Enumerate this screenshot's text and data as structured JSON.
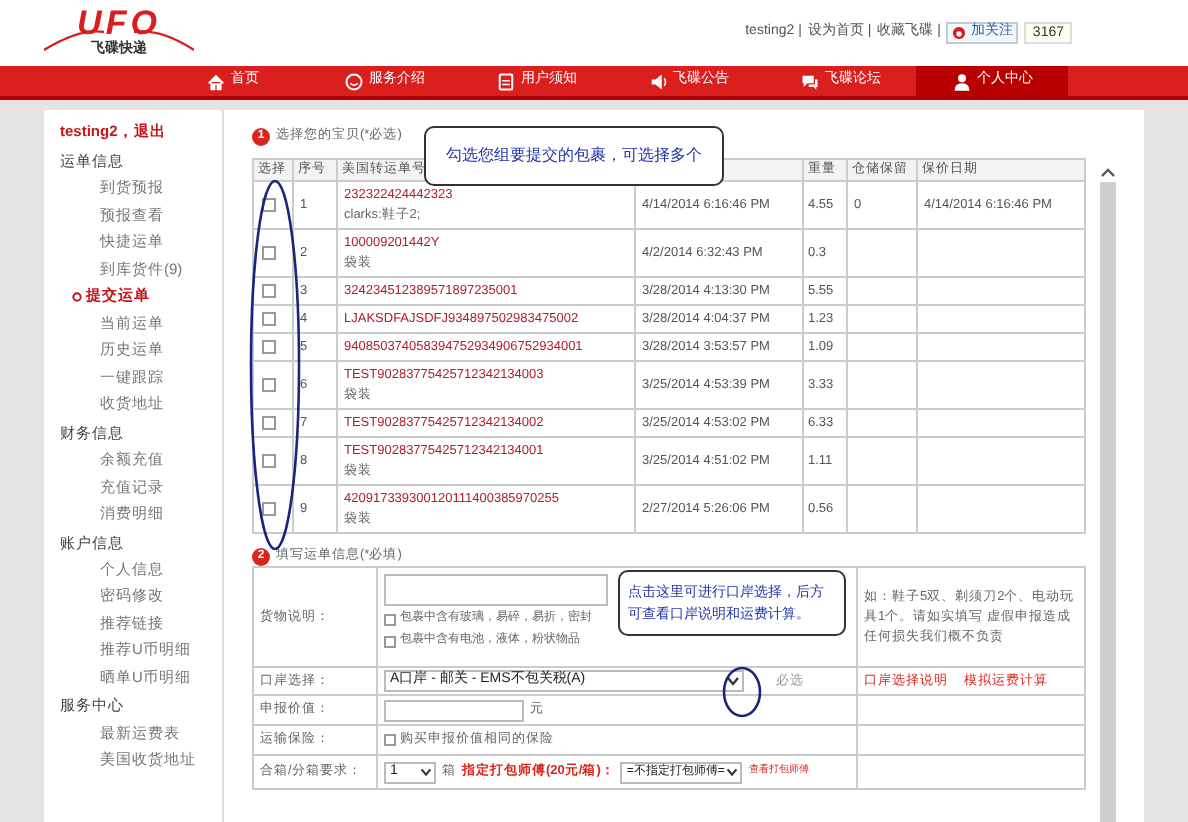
{
  "header": {
    "logo": "UFO",
    "tagline": "飞碟快递",
    "links": [
      "testing2 |",
      "设为首页 |",
      "收藏飞碟 |"
    ],
    "follow": "加关注",
    "count": "3167"
  },
  "nav": [
    {
      "label": "首页",
      "selected": false
    },
    {
      "label": "服务介绍",
      "selected": false
    },
    {
      "label": "用户须知",
      "selected": false
    },
    {
      "label": "飞碟公告",
      "selected": false
    },
    {
      "label": "飞碟论坛",
      "selected": false
    },
    {
      "label": "个人中心",
      "selected": true
    }
  ],
  "sidebar": {
    "user": "testing2，退出",
    "groups": [
      {
        "title": "运单信息",
        "items": [
          {
            "label": "到货预报",
            "selected": false
          },
          {
            "label": "预报查看",
            "selected": false
          },
          {
            "label": "快捷运单",
            "selected": false
          },
          {
            "label": "到库货件(9)",
            "selected": false
          },
          {
            "label": "提交运单",
            "selected": true
          },
          {
            "label": "当前运单",
            "selected": false
          },
          {
            "label": "历史运单",
            "selected": false
          },
          {
            "label": "一键跟踪",
            "selected": false
          },
          {
            "label": "收货地址",
            "selected": false
          }
        ]
      },
      {
        "title": "财务信息",
        "items": [
          {
            "label": "余额充值",
            "selected": false
          },
          {
            "label": "充值记录",
            "selected": false
          },
          {
            "label": "消费明细",
            "selected": false
          }
        ]
      },
      {
        "title": "账户信息",
        "items": [
          {
            "label": "个人信息",
            "selected": false
          },
          {
            "label": "密码修改",
            "selected": false
          },
          {
            "label": "推荐链接",
            "selected": false
          },
          {
            "label": "推荐U币明细",
            "selected": false
          },
          {
            "label": "晒单U币明细",
            "selected": false
          }
        ]
      },
      {
        "title": "服务中心",
        "items": [
          {
            "label": "最新运费表",
            "selected": false
          },
          {
            "label": "美国收货地址",
            "selected": false
          }
        ]
      }
    ]
  },
  "section1": {
    "number": "1",
    "title": "选择您的宝贝(*必选)",
    "columns": [
      "选择",
      "序号",
      "美国转运单号",
      "",
      "重量",
      "仓储保留",
      "保价日期"
    ],
    "rows": [
      {
        "checked": false,
        "seq": "1",
        "tracking": "232322424442323",
        "note": "clarks:鞋子2;",
        "date": "4/14/2014 6:16:46 PM",
        "weight": "4.55",
        "storage": "0",
        "insured": "4/14/2014 6:16:46 PM"
      },
      {
        "checked": false,
        "seq": "2",
        "tracking": "100009201442Y",
        "note": "袋装",
        "date": "4/2/2014 6:32:43 PM",
        "weight": "0.3"
      },
      {
        "checked": false,
        "seq": "3",
        "tracking": "3242345123895718972350​01",
        "date": "3/28/2014 4:13:30 PM",
        "weight": "5.55"
      },
      {
        "checked": false,
        "seq": "4",
        "tracking": "LJAKSDFAJSDFJ934897502983475002",
        "date": "3/28/2014 4:04:37 PM",
        "weight": "1.23"
      },
      {
        "checked": false,
        "seq": "5",
        "tracking": "940850374058394752934906752934001",
        "date": "3/28/2014 3:53:57 PM",
        "weight": "1.09"
      },
      {
        "checked": false,
        "seq": "6",
        "tracking": "TEST902837754257123421340​03",
        "note": "袋装",
        "date": "3/25/2014 4:53:39 PM",
        "weight": "3.33"
      },
      {
        "checked": false,
        "seq": "7",
        "tracking": "TEST90283775425712342134002",
        "date": "3/25/2014 4:53:02 PM",
        "weight": "6.33"
      },
      {
        "checked": false,
        "seq": "8",
        "tracking": "TEST90283775425712342134001",
        "note": "袋装",
        "date": "3/25/2014 4:51:02 PM",
        "weight": "1.11"
      },
      {
        "checked": false,
        "seq": "9",
        "tracking": "420917339300120111400385970255",
        "note": "袋装",
        "date": "2/27/2014 5:26:06 PM",
        "weight": "0.56"
      }
    ]
  },
  "section2": {
    "number": "2",
    "title": "填写运单信息(*必填)",
    "goods": {
      "label": "货物说明：",
      "options": [
        {
          "label": "包裹中含有玻璃，易碎，易折，密封",
          "checked": false
        },
        {
          "label": "包裹中含有电池，液体，粉状物品",
          "checked": false
        }
      ],
      "hint": "如：鞋子5双、剃须刀2个、电动玩具1个。请如实填写 虚假申报造成任何损失我们概不负责"
    },
    "port": {
      "label": "口岸选择：",
      "value": "A口岸 - 邮关 - EMS不包关税(A)",
      "required": "必选",
      "links": [
        "口岸选择说明",
        "模拟运费计算"
      ]
    },
    "declared": {
      "label": "申报价值：",
      "unit": "元"
    },
    "insurance": {
      "label": "运输保险：",
      "option": "购买申报价值相同的保险",
      "checked": false
    },
    "boxes": {
      "label": "合箱/分箱要求：",
      "count": "1",
      "unit": "箱",
      "packer_label": "指定打包师傅(20元/箱)：",
      "packer": "=不指定打包师傅=",
      "link": "查看打包师傅"
    }
  },
  "callouts": [
    "勾选您组要提交的包裹，可选择多个",
    "点击这里可进行口岸选择，后方可查看口岸说明和运费计算。"
  ]
}
